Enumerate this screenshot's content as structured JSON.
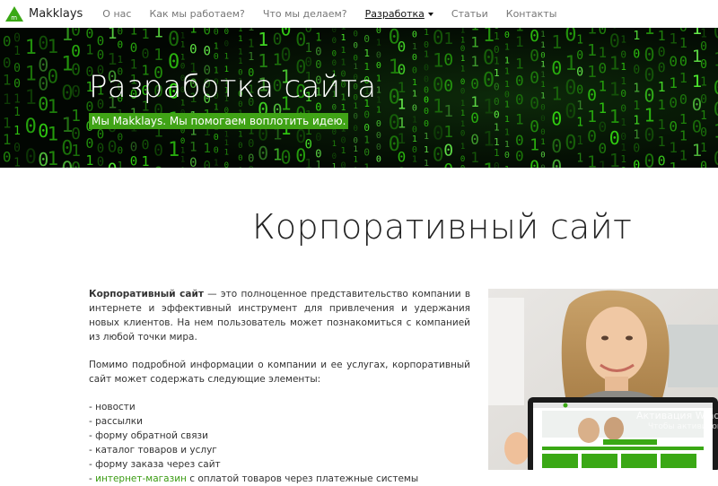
{
  "nav": {
    "brand": "Makklays",
    "logo_letter": "m",
    "items": [
      {
        "label": "О нас"
      },
      {
        "label": "Как мы работаем?"
      },
      {
        "label": "Что мы делаем?"
      },
      {
        "label": "Разработка"
      },
      {
        "label": "Статьи"
      },
      {
        "label": "Контакты"
      }
    ],
    "active_index": 3
  },
  "hero": {
    "title": "Разработка сайта",
    "subtitle": "Мы Makklays. Мы помогаем воплотить идею."
  },
  "section": {
    "title": "Корпоративный сайт",
    "intro_bold": "Корпоративный сайт",
    "intro_rest": " — это полноценное представительство компании в интернете и эффективный инструмент для привлечения и удержания новых клиентов. На нем пользователь может познакомиться с компанией из любой точки мира.",
    "para2": "Помимо подробной информации о компании и ее услугах, корпоративный сайт может содержать следующие элементы:",
    "list": [
      "- новости",
      "- рассылки",
      "- форму обратной связи",
      "- каталог товаров и услуг",
      "- форму заказа через сайт"
    ],
    "last_item_prefix": "- ",
    "last_item_link": "интернет-магазин",
    "last_item_rest": " с оплатой товаров через платежные системы"
  },
  "watermark": {
    "line1": "Активация Windows",
    "line2": "Чтобы активировать"
  },
  "colors": {
    "accent_green": "#40a316",
    "link_green": "#3a9b12"
  }
}
